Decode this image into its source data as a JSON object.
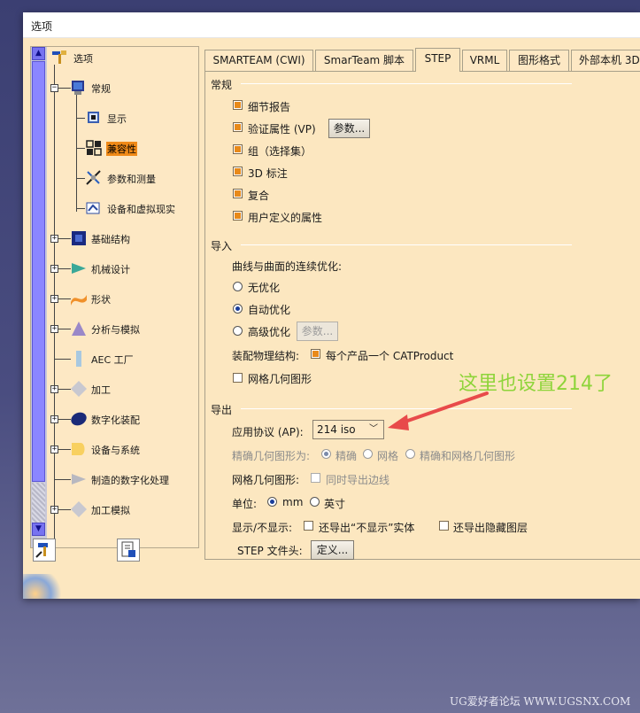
{
  "window": {
    "title": "选项"
  },
  "tree": {
    "items": [
      {
        "label": "选项",
        "icon": "options-root-icon"
      },
      {
        "label": "常规",
        "icon": "general-icon"
      },
      {
        "label": "显示",
        "icon": "display-icon"
      },
      {
        "label": "兼容性",
        "icon": "compatibility-icon",
        "selected": true
      },
      {
        "label": "参数和测量",
        "icon": "parameters-measure-icon"
      },
      {
        "label": "设备和虚拟现实",
        "icon": "devices-vr-icon"
      },
      {
        "label": "基础结构",
        "icon": "infrastructure-icon"
      },
      {
        "label": "机械设计",
        "icon": "mechanical-design-icon"
      },
      {
        "label": "形状",
        "icon": "shape-icon"
      },
      {
        "label": "分析与模拟",
        "icon": "analysis-simulation-icon"
      },
      {
        "label": "AEC 工厂",
        "icon": "aec-plant-icon"
      },
      {
        "label": "加工",
        "icon": "machining-icon"
      },
      {
        "label": "数字化装配",
        "icon": "digital-mockup-icon"
      },
      {
        "label": "设备与系统",
        "icon": "equipment-systems-icon"
      },
      {
        "label": "制造的数字化处理",
        "icon": "digital-manufacturing-icon"
      },
      {
        "label": "加工模拟",
        "icon": "machining-simulation-icon"
      }
    ]
  },
  "tabs": [
    {
      "label": "SMARTEAM (CWI)"
    },
    {
      "label": "SmarTeam 脚本"
    },
    {
      "label": "STEP",
      "active": true
    },
    {
      "label": "VRML"
    },
    {
      "label": "图形格式"
    },
    {
      "label": "外部本机 3D"
    }
  ],
  "general": {
    "title": "常规",
    "detail_report": "细节报告",
    "validation_props": "验证属性 (VP)",
    "params_button": "参数...",
    "groups": "组（选择集）",
    "annotation_3d": "3D 标注",
    "composites": "复合",
    "user_props": "用户定义的属性"
  },
  "import": {
    "title": "导入",
    "curve_opt_label": "曲线与曲面的连续优化:",
    "no_opt": "无优化",
    "auto_opt": "自动优化",
    "adv_opt": "高级优化",
    "adv_params_button": "参数...",
    "assembly_label": "装配物理结构:",
    "per_product": "每个产品一个 CATProduct",
    "mesh_geometry": "网格几何图形"
  },
  "export": {
    "title": "导出",
    "ap_label": "应用协议 (AP):",
    "ap_value": "214 iso",
    "exact_label": "精确几何图形为:",
    "exact": "精确",
    "mesh": "网格",
    "exact_and_mesh": "精确和网格几何图形",
    "mesh_geom_label": "网格几何图形:",
    "export_edges": "同时导出边线",
    "unit_label": "单位:",
    "mm": "mm",
    "inch": "英寸",
    "show_label": "显示/不显示:",
    "export_noshow": "还导出“不显示”实体",
    "export_hidden_layers": "还导出隐藏图层",
    "step_header_label": "STEP 文件头:",
    "define_button": "定义..."
  },
  "annotation": {
    "text": "这里也设置214了",
    "color": "#8ed43a",
    "arrow_color": "#e84a4a"
  },
  "watermark": {
    "text": "UG爱好者论坛 WWW.UGSNX.COM"
  }
}
